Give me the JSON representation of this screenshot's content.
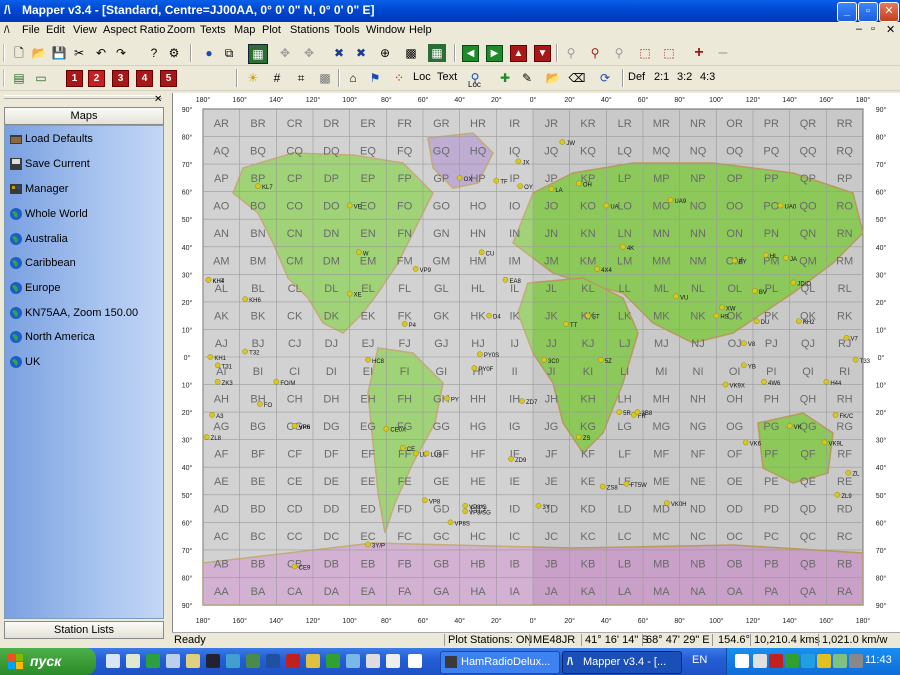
{
  "window": {
    "title": "Mapper v3.4 - [Standard, Centre=JJ00AA, 0° 0' 0\" N, 0° 0' 0\" E]"
  },
  "menu": [
    "File",
    "Edit",
    "View",
    "Aspect Ratio",
    "Zoom",
    "Texts",
    "Map",
    "Plot",
    "Stations",
    "Tools",
    "Window",
    "Help"
  ],
  "toolbar2": {
    "numbers": [
      "1",
      "2",
      "3",
      "4",
      "5"
    ],
    "loc_label": "Loc",
    "text_label": "Text",
    "loc_small": "Loc",
    "def_label": "Def",
    "ratio_21": "2:1",
    "ratio_32": "3:2",
    "ratio_43": "4:3"
  },
  "sidebar": {
    "header": "Maps",
    "items": [
      {
        "label": "Load Defaults",
        "icon": "folder-icon"
      },
      {
        "label": "Save Current",
        "icon": "save-icon"
      },
      {
        "label": "Manager",
        "icon": "manager-icon"
      },
      {
        "label": "Whole World",
        "icon": "globe-icon"
      },
      {
        "label": "Australia",
        "icon": "globe-icon"
      },
      {
        "label": "Caribbean",
        "icon": "globe-icon"
      },
      {
        "label": "Europe",
        "icon": "globe-icon"
      },
      {
        "label": "KN75AA, Zoom 150.00",
        "icon": "globe-icon"
      },
      {
        "label": "North America",
        "icon": "globe-icon"
      },
      {
        "label": "UK",
        "icon": "globe-icon"
      }
    ],
    "footer": "Station Lists"
  },
  "map": {
    "lon_labels": [
      "180°",
      "160°",
      "140°",
      "120°",
      "100°",
      "80°",
      "60°",
      "40°",
      "20°",
      "0°",
      "20°",
      "40°",
      "60°",
      "80°",
      "100°",
      "120°",
      "140°",
      "160°",
      "180°"
    ],
    "lat_labels": [
      "90°",
      "80°",
      "70°",
      "60°",
      "50°",
      "40°",
      "30°",
      "20°",
      "10°",
      "0°",
      "10°",
      "20°",
      "30°",
      "40°",
      "50°",
      "60°",
      "70°",
      "80°",
      "90°"
    ],
    "grid_rows": [
      [
        "AR",
        "BR",
        "CR",
        "DR",
        "ER",
        "FR",
        "GR",
        "HR",
        "IR",
        "JR",
        "KR",
        "LR",
        "MR",
        "NR",
        "OR",
        "PR",
        "QR",
        "RR"
      ],
      [
        "AQ",
        "BQ",
        "CQ",
        "DQ",
        "EQ",
        "FQ",
        "GQ",
        "HQ",
        "IQ",
        "JQ",
        "KQ",
        "LQ",
        "MQ",
        "NQ",
        "OQ",
        "PQ",
        "QQ",
        "RQ"
      ],
      [
        "AP",
        "BP",
        "CP",
        "DP",
        "EP",
        "FP",
        "GP",
        "HP",
        "IP",
        "JP",
        "KP",
        "LP",
        "MP",
        "NP",
        "OP",
        "PP",
        "QP",
        "RP"
      ],
      [
        "AO",
        "BO",
        "CO",
        "DO",
        "EO",
        "FO",
        "GO",
        "HO",
        "IO",
        "JO",
        "KO",
        "LO",
        "MO",
        "NO",
        "OO",
        "PO",
        "QO",
        "RO"
      ],
      [
        "AN",
        "BN",
        "CN",
        "DN",
        "EN",
        "FN",
        "GN",
        "HN",
        "IN",
        "JN",
        "KN",
        "LN",
        "MN",
        "NN",
        "ON",
        "PN",
        "QN",
        "RN"
      ],
      [
        "AM",
        "BM",
        "CM",
        "DM",
        "EM",
        "FM",
        "GM",
        "HM",
        "IM",
        "JM",
        "KM",
        "LM",
        "MM",
        "NM",
        "OM",
        "PM",
        "QM",
        "RM"
      ],
      [
        "AL",
        "BL",
        "CL",
        "DL",
        "EL",
        "FL",
        "GL",
        "HL",
        "IL",
        "JL",
        "KL",
        "LL",
        "ML",
        "NL",
        "OL",
        "PL",
        "QL",
        "RL"
      ],
      [
        "AK",
        "BK",
        "CK",
        "DK",
        "EK",
        "FK",
        "GK",
        "HK",
        "IK",
        "JK",
        "KK",
        "LK",
        "MK",
        "NK",
        "OK",
        "PK",
        "QK",
        "RK"
      ],
      [
        "AJ",
        "BJ",
        "CJ",
        "DJ",
        "EJ",
        "FJ",
        "GJ",
        "HJ",
        "IJ",
        "JJ",
        "KJ",
        "LJ",
        "MJ",
        "NJ",
        "OJ",
        "PJ",
        "QJ",
        "RJ"
      ],
      [
        "AI",
        "BI",
        "CI",
        "DI",
        "EI",
        "FI",
        "GI",
        "HI",
        "II",
        "JI",
        "KI",
        "LI",
        "MI",
        "NI",
        "OI",
        "PI",
        "QI",
        "RI"
      ],
      [
        "AH",
        "BH",
        "CH",
        "DH",
        "EH",
        "FH",
        "GH",
        "HH",
        "IH",
        "JH",
        "KH",
        "LH",
        "MH",
        "NH",
        "OH",
        "PH",
        "QH",
        "RH"
      ],
      [
        "AG",
        "BG",
        "CG",
        "DG",
        "EG",
        "FG",
        "GG",
        "HG",
        "IG",
        "JG",
        "KG",
        "LG",
        "MG",
        "NG",
        "OG",
        "PG",
        "QG",
        "RG"
      ],
      [
        "AF",
        "BF",
        "CF",
        "DF",
        "EF",
        "FF",
        "GF",
        "HF",
        "IF",
        "JF",
        "KF",
        "LF",
        "MF",
        "NF",
        "OF",
        "PF",
        "QF",
        "RF"
      ],
      [
        "AE",
        "BE",
        "CE",
        "DE",
        "EE",
        "FE",
        "GE",
        "HE",
        "IE",
        "JE",
        "KE",
        "LE",
        "ME",
        "NE",
        "OE",
        "PE",
        "QE",
        "RE"
      ],
      [
        "AD",
        "BD",
        "CD",
        "DD",
        "ED",
        "FD",
        "GD",
        "HD",
        "ID",
        "JD",
        "KD",
        "LD",
        "MD",
        "ND",
        "OD",
        "PD",
        "QD",
        "RD"
      ],
      [
        "AC",
        "BC",
        "CC",
        "DC",
        "EC",
        "FC",
        "GC",
        "HC",
        "IC",
        "JC",
        "KC",
        "LC",
        "MC",
        "NC",
        "OC",
        "PC",
        "QC",
        "RC"
      ],
      [
        "AB",
        "BB",
        "CB",
        "DB",
        "EB",
        "FB",
        "GB",
        "HB",
        "IB",
        "JB",
        "KB",
        "LB",
        "MB",
        "NB",
        "OB",
        "PB",
        "QB",
        "RB"
      ],
      [
        "AA",
        "BA",
        "CA",
        "DA",
        "EA",
        "FA",
        "GA",
        "HA",
        "IA",
        "JA",
        "KA",
        "LA",
        "MA",
        "NA",
        "OA",
        "PA",
        "QA",
        "RA"
      ]
    ],
    "stations": [
      {
        "call": "4X4",
        "lon": 35,
        "lat": 32
      },
      {
        "call": "JW",
        "lon": 16,
        "lat": 78
      },
      {
        "call": "4K",
        "lon": 49,
        "lat": 40
      },
      {
        "call": "JX",
        "lon": -8,
        "lat": 71
      },
      {
        "call": "OX",
        "lon": -40,
        "lat": 65
      },
      {
        "call": "TF",
        "lon": -20,
        "lat": 64
      },
      {
        "call": "VE",
        "lon": -100,
        "lat": 55
      },
      {
        "call": "KL7",
        "lon": -150,
        "lat": 62
      },
      {
        "call": "OY",
        "lon": -7,
        "lat": 62
      },
      {
        "call": "LA",
        "lon": 10,
        "lat": 61
      },
      {
        "call": "OH",
        "lon": 25,
        "lat": 63
      },
      {
        "call": "UA",
        "lon": 40,
        "lat": 55
      },
      {
        "call": "UA9",
        "lon": 75,
        "lat": 57
      },
      {
        "call": "UA0",
        "lon": 135,
        "lat": 55
      },
      {
        "call": "JA",
        "lon": 138,
        "lat": 36
      },
      {
        "call": "BY",
        "lon": 110,
        "lat": 35
      },
      {
        "call": "VU",
        "lon": 78,
        "lat": 22
      },
      {
        "call": "HS",
        "lon": 100,
        "lat": 15
      },
      {
        "call": "YB",
        "lon": 115,
        "lat": -3
      },
      {
        "call": "VK",
        "lon": 140,
        "lat": -25
      },
      {
        "call": "ZL",
        "lon": 172,
        "lat": -42
      },
      {
        "call": "ZS",
        "lon": 25,
        "lat": -29
      },
      {
        "call": "5Z",
        "lon": 37,
        "lat": -1
      },
      {
        "call": "ZD9",
        "lon": -12,
        "lat": -37
      },
      {
        "call": "ZD7",
        "lon": -6,
        "lat": -16
      },
      {
        "call": "PY",
        "lon": -47,
        "lat": -15
      },
      {
        "call": "LU",
        "lon": -64,
        "lat": -35
      },
      {
        "call": "CE",
        "lon": -71,
        "lat": -33
      },
      {
        "call": "CE0X",
        "lon": -80,
        "lat": -26
      },
      {
        "call": "VP8",
        "lon": -59,
        "lat": -52
      },
      {
        "call": "LU9",
        "lon": -58,
        "lat": -35
      },
      {
        "call": "VP8/G",
        "lon": -37,
        "lat": -54
      },
      {
        "call": "VP8S",
        "lon": -45,
        "lat": -60
      },
      {
        "call": "3Y/P",
        "lon": -90,
        "lat": -68
      },
      {
        "call": "CE9",
        "lon": -130,
        "lat": -76
      },
      {
        "call": "KH6",
        "lon": -157,
        "lat": 21
      },
      {
        "call": "KH7",
        "lon": -177,
        "lat": 28
      },
      {
        "call": "KH4",
        "lon": -177,
        "lat": 28
      },
      {
        "call": "XE",
        "lon": -100,
        "lat": 23
      },
      {
        "call": "W",
        "lon": -95,
        "lat": 38
      },
      {
        "call": "VP9",
        "lon": -64,
        "lat": 32
      },
      {
        "call": "CU",
        "lon": -28,
        "lat": 38
      },
      {
        "call": "EA8",
        "lon": -15,
        "lat": 28
      },
      {
        "call": "D4",
        "lon": -24,
        "lat": 15
      },
      {
        "call": "3C0",
        "lon": 6,
        "lat": -1
      },
      {
        "call": "TT",
        "lon": 18,
        "lat": 12
      },
      {
        "call": "ST",
        "lon": 30,
        "lat": 15
      },
      {
        "call": "5R",
        "lon": 47,
        "lat": -20
      },
      {
        "call": "FR",
        "lon": 55,
        "lat": -21
      },
      {
        "call": "3B8",
        "lon": 57,
        "lat": -20
      },
      {
        "call": "FT5W",
        "lon": 51,
        "lat": -46
      },
      {
        "call": "VK0H",
        "lon": 73,
        "lat": -53
      },
      {
        "call": "VK9X",
        "lon": 105,
        "lat": -10
      },
      {
        "call": "VK6",
        "lon": 116,
        "lat": -31
      },
      {
        "call": "KH2",
        "lon": 145,
        "lat": 13
      },
      {
        "call": "V7",
        "lon": 171,
        "lat": 7
      },
      {
        "call": "T33",
        "lon": 176,
        "lat": -1
      },
      {
        "call": "H44",
        "lon": 160,
        "lat": -9
      },
      {
        "call": "FK/C",
        "lon": 165,
        "lat": -21
      },
      {
        "call": "VK9L",
        "lon": 159,
        "lat": -31
      },
      {
        "call": "ZL9",
        "lon": 166,
        "lat": -50
      },
      {
        "call": "A3",
        "lon": -175,
        "lat": -21
      },
      {
        "call": "ZL8",
        "lon": -178,
        "lat": -29
      },
      {
        "call": "ZK3",
        "lon": -172,
        "lat": -9
      },
      {
        "call": "FO",
        "lon": -149,
        "lat": -17
      },
      {
        "call": "VP6",
        "lon": -130,
        "lat": -25
      },
      {
        "call": "HC8",
        "lon": -90,
        "lat": -1
      },
      {
        "call": "P4",
        "lon": -70,
        "lat": 12
      },
      {
        "call": "PY0F",
        "lon": -32,
        "lat": -4
      },
      {
        "call": "PY0S",
        "lon": -29,
        "lat": 1
      },
      {
        "call": "ZS8",
        "lon": 38,
        "lat": -47
      },
      {
        "call": "3Y",
        "lon": 3,
        "lat": -54
      },
      {
        "call": "VP8/SG",
        "lon": -37,
        "lat": -56
      },
      {
        "call": "VR6",
        "lon": -130,
        "lat": -25
      },
      {
        "call": "FO/M",
        "lon": -140,
        "lat": -9
      },
      {
        "call": "T32",
        "lon": -157,
        "lat": 2
      },
      {
        "call": "KH1",
        "lon": -176,
        "lat": 0
      },
      {
        "call": "T31",
        "lon": -172,
        "lat": -3
      },
      {
        "call": "4W6",
        "lon": 126,
        "lat": -9
      },
      {
        "call": "V8",
        "lon": 115,
        "lat": 5
      },
      {
        "call": "XW",
        "lon": 103,
        "lat": 18
      },
      {
        "call": "BV",
        "lon": 121,
        "lat": 24
      },
      {
        "call": "DU",
        "lon": 122,
        "lat": 13
      },
      {
        "call": "JD/O",
        "lon": 142,
        "lat": 27
      },
      {
        "call": "HL",
        "lon": 127,
        "lat": 37
      }
    ]
  },
  "status": {
    "ready": "Ready",
    "plot_stations": "Plot Stations: ON",
    "locator": "ME48JR",
    "lat": "41° 16' 14\" S",
    "lon": "68° 47' 29\" E",
    "bearing": "154.6°",
    "distance": "10,210.4 kms",
    "scale": "1,021.0 km/w"
  },
  "taskbar": {
    "start": "пуск",
    "task1": "HamRadioDelux...",
    "task2": "Mapper v3.4 - [...",
    "lang": "EN",
    "clock": "11:43"
  },
  "colors": {
    "titlebar": "#0048d0",
    "sidebar_gradient": "#7aa0e0",
    "station_dot": "#d6c81e",
    "ocean": "#c9c9c9"
  }
}
